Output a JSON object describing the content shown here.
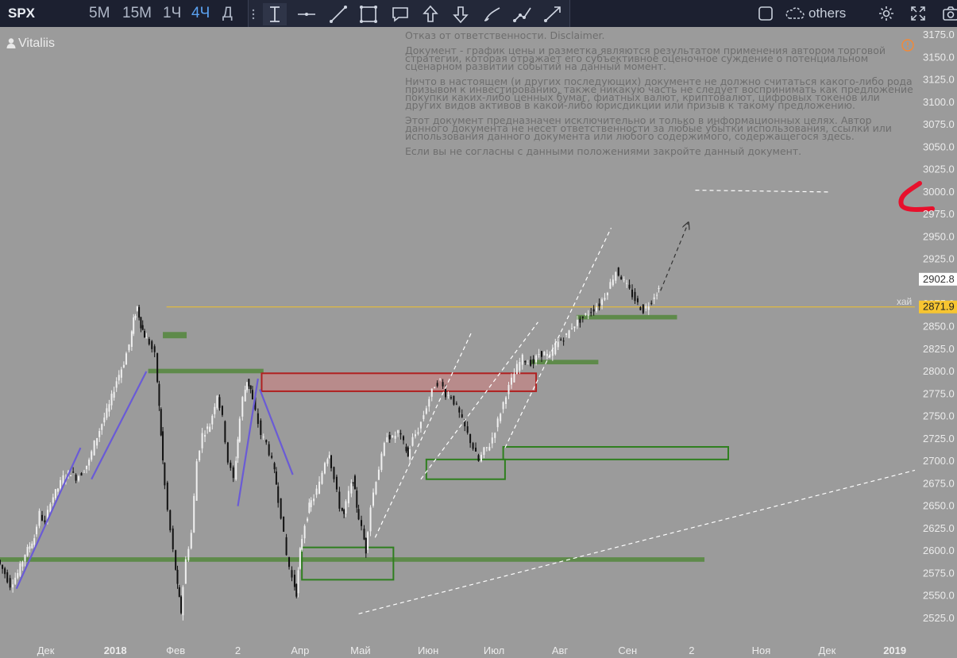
{
  "toolbar": {
    "symbol": "SPX",
    "timeframes": [
      "5M",
      "15M",
      "1Ч",
      "4Ч",
      "Д"
    ],
    "active_timeframe": "4Ч",
    "drawing_tools": [
      "cursor-text-icon",
      "horizontal-line-icon",
      "trend-line-icon",
      "rectangle-icon",
      "callout-icon",
      "arrow-up-icon",
      "arrow-down-icon",
      "brush-icon",
      "path-icon",
      "arrow-line-icon"
    ],
    "others_label": "others",
    "icons": [
      "square-icon",
      "cloud-icon",
      "gear-icon",
      "fullscreen-icon",
      "camera-icon"
    ]
  },
  "author": "Vitaliis",
  "disclaimer": [
    "Отказ от ответственности. Disclaimer.",
    "Документ - график цены и разметка являются результатом применения автором торговой стратегии, которая отражает его субъективное оценочное суждение о потенциальном сценарном развитии событий на данный момент.",
    "Ничто в настоящем (и других последующих) документе не должно считаться какого-либо рода призывом к инвестированию, также никакую часть не следует воспринимать как предложение покупки каких-либо ценных бумаг, фиатных валют, криптовалют, цифровых токенов или других видов активов в какой-либо юрисдикции или призыв к такому предложению.",
    "Этот документ предназначен исключительно и только в информационных целях. Автор данного документа не несет ответственности за любые убытки использования, ссылки или использования данного документа или любого содержимого, содержащегося здесь.",
    "Если вы не согласны с данными положениями закройте данный документ."
  ],
  "chart_data": {
    "type": "candlestick",
    "symbol": "SPX",
    "timeframe": "4Ч",
    "y_axis": {
      "ticks": [
        3175,
        3150,
        3125,
        3100,
        3075,
        3050,
        3025,
        3000,
        2975,
        2950,
        2925,
        2900,
        2875,
        2850,
        2825,
        2800,
        2775,
        2750,
        2725,
        2700,
        2675,
        2650,
        2625,
        2600,
        2575,
        2550,
        2525
      ],
      "tick_labels": [
        "3175.0",
        "3150.0",
        "3125.0",
        "3100.0",
        "3075.0",
        "3050.0",
        "3025.0",
        "3000.0",
        "2975.0",
        "2950.0",
        "2925.0",
        "2900.0",
        "2875.0",
        "2850.0",
        "2825.0",
        "2800.0",
        "2775.0",
        "2750.0",
        "2725.0",
        "2700.0",
        "2675.0",
        "2650.0",
        "2625.0",
        "2600.0",
        "2575.0",
        "2550.0",
        "2525.0"
      ],
      "range": [
        2510,
        3185
      ]
    },
    "x_axis": {
      "labels": [
        "Дек",
        "2018",
        "Фев",
        "2",
        "Апр",
        "Май",
        "Июн",
        "Июл",
        "Авг",
        "Сен",
        "2",
        "Ноя",
        "Дек",
        "2019"
      ],
      "bold": [
        "2018",
        "2019"
      ]
    },
    "price_tags": [
      {
        "label": "2902.8",
        "value": 2902.8,
        "color": "#ffffff",
        "text_color": "#333333"
      },
      {
        "label": "2871.9",
        "value": 2871.9,
        "color": "#f7c531",
        "text_color": "#222222"
      }
    ],
    "horizontal_line": {
      "value": 2871.9,
      "label": "хай",
      "color": "#f2c22a"
    },
    "price_path": [
      [
        0.0,
        2590
      ],
      [
        0.4,
        2575
      ],
      [
        0.7,
        2562
      ],
      [
        1.1,
        2575
      ],
      [
        1.5,
        2597
      ],
      [
        2.0,
        2615
      ],
      [
        2.3,
        2642
      ],
      [
        2.6,
        2630
      ],
      [
        2.9,
        2656
      ],
      [
        3.3,
        2670
      ],
      [
        3.6,
        2682
      ],
      [
        4.0,
        2688
      ],
      [
        4.3,
        2682
      ],
      [
        4.6,
        2687
      ],
      [
        5.0,
        2700
      ],
      [
        5.3,
        2720
      ],
      [
        5.7,
        2742
      ],
      [
        6.1,
        2762
      ],
      [
        6.5,
        2790
      ],
      [
        6.9,
        2810
      ],
      [
        7.2,
        2830
      ],
      [
        7.4,
        2857
      ],
      [
        7.6,
        2872
      ],
      [
        7.8,
        2852
      ],
      [
        8.0,
        2840
      ],
      [
        8.3,
        2832
      ],
      [
        8.6,
        2818
      ],
      [
        8.8,
        2760
      ],
      [
        9.0,
        2700
      ],
      [
        9.3,
        2645
      ],
      [
        9.6,
        2600
      ],
      [
        9.8,
        2560
      ],
      [
        10.0,
        2532
      ],
      [
        10.3,
        2590
      ],
      [
        10.6,
        2620
      ],
      [
        10.9,
        2700
      ],
      [
        11.2,
        2730
      ],
      [
        11.6,
        2740
      ],
      [
        12.0,
        2775
      ],
      [
        12.3,
        2748
      ],
      [
        12.6,
        2700
      ],
      [
        12.9,
        2680
      ],
      [
        13.1,
        2725
      ],
      [
        13.4,
        2770
      ],
      [
        13.6,
        2790
      ],
      [
        13.8,
        2780
      ],
      [
        14.1,
        2755
      ],
      [
        14.4,
        2730
      ],
      [
        14.7,
        2720
      ],
      [
        15.0,
        2700
      ],
      [
        15.2,
        2675
      ],
      [
        15.5,
        2640
      ],
      [
        15.8,
        2595
      ],
      [
        16.1,
        2570
      ],
      [
        16.3,
        2553
      ],
      [
        16.5,
        2600
      ],
      [
        16.8,
        2630
      ],
      [
        17.0,
        2650
      ],
      [
        17.3,
        2660
      ],
      [
        17.6,
        2675
      ],
      [
        17.9,
        2700
      ],
      [
        18.1,
        2710
      ],
      [
        18.4,
        2680
      ],
      [
        18.7,
        2650
      ],
      [
        18.9,
        2640
      ],
      [
        19.2,
        2665
      ],
      [
        19.4,
        2680
      ],
      [
        19.6,
        2650
      ],
      [
        19.9,
        2625
      ],
      [
        20.1,
        2600
      ],
      [
        20.4,
        2650
      ],
      [
        20.7,
        2680
      ],
      [
        21.0,
        2705
      ],
      [
        21.3,
        2730
      ],
      [
        21.6,
        2725
      ],
      [
        21.9,
        2733
      ],
      [
        22.2,
        2720
      ],
      [
        22.4,
        2705
      ],
      [
        22.7,
        2725
      ],
      [
        23.0,
        2735
      ],
      [
        23.3,
        2752
      ],
      [
        23.6,
        2770
      ],
      [
        23.9,
        2785
      ],
      [
        24.2,
        2790
      ],
      [
        24.5,
        2775
      ],
      [
        24.8,
        2772
      ],
      [
        25.1,
        2760
      ],
      [
        25.4,
        2745
      ],
      [
        25.7,
        2730
      ],
      [
        26.0,
        2715
      ],
      [
        26.3,
        2700
      ],
      [
        26.6,
        2712
      ],
      [
        26.9,
        2718
      ],
      [
        27.2,
        2735
      ],
      [
        27.5,
        2755
      ],
      [
        27.8,
        2775
      ],
      [
        28.1,
        2790
      ],
      [
        28.4,
        2805
      ],
      [
        28.7,
        2815
      ],
      [
        29.0,
        2810
      ],
      [
        29.3,
        2810
      ],
      [
        29.6,
        2820
      ],
      [
        29.9,
        2820
      ],
      [
        30.2,
        2815
      ],
      [
        30.5,
        2830
      ],
      [
        30.8,
        2835
      ],
      [
        31.1,
        2840
      ],
      [
        31.4,
        2850
      ],
      [
        31.7,
        2855
      ],
      [
        32.0,
        2860
      ],
      [
        32.3,
        2865
      ],
      [
        32.6,
        2870
      ],
      [
        32.9,
        2875
      ],
      [
        33.2,
        2885
      ],
      [
        33.5,
        2898
      ],
      [
        33.8,
        2912
      ],
      [
        34.1,
        2905
      ],
      [
        34.4,
        2895
      ],
      [
        34.7,
        2885
      ],
      [
        35.0,
        2875
      ],
      [
        35.3,
        2868
      ],
      [
        35.6,
        2875
      ],
      [
        35.9,
        2885
      ],
      [
        36.1,
        2892
      ]
    ],
    "x_tick_positions": {
      "Дек": 2.5,
      "2018": 6.3,
      "Фев": 9.6,
      "2": 13.0,
      "Апр": 16.4,
      "Май": 19.7,
      "Июн": 23.4,
      "Июл": 27.0,
      "Авг": 30.6,
      "Сен": 34.3,
      "2_b": 37.8,
      "Ноя": 41.6,
      "Дек_b": 45.2,
      "2019": 48.9
    },
    "x_range": [
      0,
      50
    ],
    "zones": [
      {
        "type": "support",
        "style": "bar",
        "color": "#5e8a4a",
        "x0": 0.0,
        "x1": 38.5,
        "y0": 2588,
        "y1": 2593
      },
      {
        "type": "support",
        "style": "bar",
        "color": "#5e8a4a",
        "x0": 8.1,
        "x1": 14.4,
        "y0": 2798,
        "y1": 2803
      },
      {
        "type": "support",
        "style": "bar",
        "color": "#5e8a4a",
        "x0": 8.9,
        "x1": 10.2,
        "y0": 2837,
        "y1": 2844
      },
      {
        "type": "support",
        "style": "bar",
        "color": "#5e8a4a",
        "x0": 29.0,
        "x1": 32.7,
        "y0": 2808,
        "y1": 2813
      },
      {
        "type": "support",
        "style": "bar",
        "color": "#5e8a4a",
        "x0": 31.5,
        "x1": 37.0,
        "y0": 2858,
        "y1": 2863
      },
      {
        "type": "resistance",
        "style": "box",
        "color": "#b02020",
        "fill": "rgba(220,120,120,0.45)",
        "x0": 14.3,
        "x1": 29.3,
        "y0": 2778,
        "y1": 2798
      },
      {
        "type": "support",
        "style": "box",
        "color": "#2f7f1f",
        "fill": "none",
        "x0": 16.5,
        "x1": 21.5,
        "y0": 2568,
        "y1": 2604
      },
      {
        "type": "support",
        "style": "box",
        "color": "#2f7f1f",
        "fill": "none",
        "x0": 23.3,
        "x1": 27.6,
        "y0": 2680,
        "y1": 2702
      },
      {
        "type": "support",
        "style": "box",
        "color": "#2f7f1f",
        "fill": "none",
        "x0": 27.5,
        "x1": 39.8,
        "y0": 2702,
        "y1": 2716
      }
    ],
    "trend_lines": [
      {
        "color": "#6a5bd6",
        "dash": false,
        "x0": 0.9,
        "y0": 2558,
        "x1": 4.4,
        "y1": 2715
      },
      {
        "color": "#6a5bd6",
        "dash": false,
        "x0": 5.0,
        "y0": 2680,
        "x1": 8.0,
        "y1": 2800
      },
      {
        "color": "#6a5bd6",
        "dash": false,
        "x0": 13.0,
        "y0": 2650,
        "x1": 14.1,
        "y1": 2792
      },
      {
        "color": "#6a5bd6",
        "dash": false,
        "x0": 14.2,
        "y0": 2780,
        "x1": 16.0,
        "y1": 2685
      },
      {
        "color": "#ffffff",
        "dash": true,
        "x0": 20.5,
        "y0": 2615,
        "x1": 25.8,
        "y1": 2845
      },
      {
        "color": "#ffffff",
        "dash": true,
        "x0": 23.0,
        "y0": 2680,
        "x1": 29.4,
        "y1": 2855
      },
      {
        "color": "#ffffff",
        "dash": true,
        "x0": 27.6,
        "y0": 2715,
        "x1": 33.4,
        "y1": 2960
      },
      {
        "color": "#ffffff",
        "dash": true,
        "x0": 19.6,
        "y0": 2530,
        "x1": 50.0,
        "y1": 2690
      },
      {
        "color": "#ffffff",
        "dash": true,
        "x0": 38.0,
        "y0": 3002,
        "x1": 45.4,
        "y1": 3000
      },
      {
        "color": "#333333",
        "dash": true,
        "arrow": true,
        "x0": 36.1,
        "y0": 2890,
        "x1": 37.6,
        "y1": 2965
      }
    ],
    "annotation_mark": {
      "color": "#e8102c",
      "level": 2987
    }
  }
}
